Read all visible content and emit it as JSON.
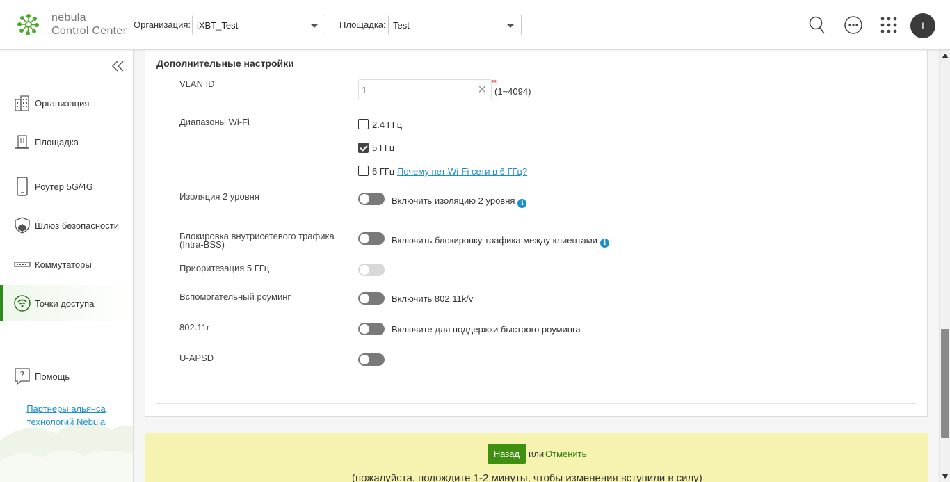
{
  "header": {
    "brand_line1": "nebula",
    "brand_line2": "Control Center",
    "org_label": "Организация:",
    "org_value": "iXBT_Test",
    "site_label": "Площадка:",
    "site_value": "Test",
    "icons": [
      "search-icon",
      "more-icon",
      "apps-grid-icon"
    ],
    "avatar_letter": "I"
  },
  "sidebar": {
    "items": [
      {
        "label": "Организация",
        "icon": "building-icon"
      },
      {
        "label": "Площадка",
        "icon": "site-icon"
      },
      {
        "label": "Роутер 5G/4G",
        "icon": "mobile-router-icon"
      },
      {
        "label": "Шлюз безопасности",
        "icon": "shield-icon"
      },
      {
        "label": "Коммутаторы",
        "icon": "switch-icon"
      },
      {
        "label": "Точки доступа",
        "icon": "wifi-ap-icon",
        "active": true
      },
      {
        "label": "Помощь",
        "icon": "help-icon"
      }
    ],
    "partners_link": "Партнеры альянса технологий Nebula"
  },
  "settings": {
    "section_title": "Дополнительные настройки",
    "vlan_label": "VLAN ID",
    "vlan_value": "1",
    "vlan_range": "(1~4094)",
    "bands_label": "Диапазоны Wi-Fi",
    "band_24": {
      "label": "2.4 ГГц",
      "checked": false
    },
    "band_5": {
      "label": "5 ГГц",
      "checked": true
    },
    "band_6": {
      "label": "6 ГГц",
      "checked": false
    },
    "band_6_link": "Почему нет Wi-Fi сети в 6 ГГц?",
    "l2_label": "Изоляция 2 уровня",
    "l2_toggle_text": "Включить изоляцию 2 уровня",
    "intra_label_line1": "Блокировка внутрисетевого трафика",
    "intra_label_line2": "(Intra-BSS)",
    "intra_toggle_text": "Включить блокировку трафика между клиентами",
    "prio_label": "Приоритезация 5 ГГц",
    "roam_label": "Вспомогательный роуминг",
    "roam_toggle_text": "Включить 802.11k/v",
    "r_label": "802.11r",
    "r_toggle_text": "Включите для поддержки быстрого роуминга",
    "uapsd_label": "U-APSD"
  },
  "actions": {
    "back_label": "Назад",
    "or_text": "или",
    "cancel_label": "Отменить",
    "note": "(пожалуйста, подождите 1-2 минуты, чтобы изменения вступили в силу)"
  },
  "colors": {
    "accent_green": "#3f8f10",
    "link_blue": "#1a8fd0",
    "action_bar_bg": "#f6f3b0"
  }
}
